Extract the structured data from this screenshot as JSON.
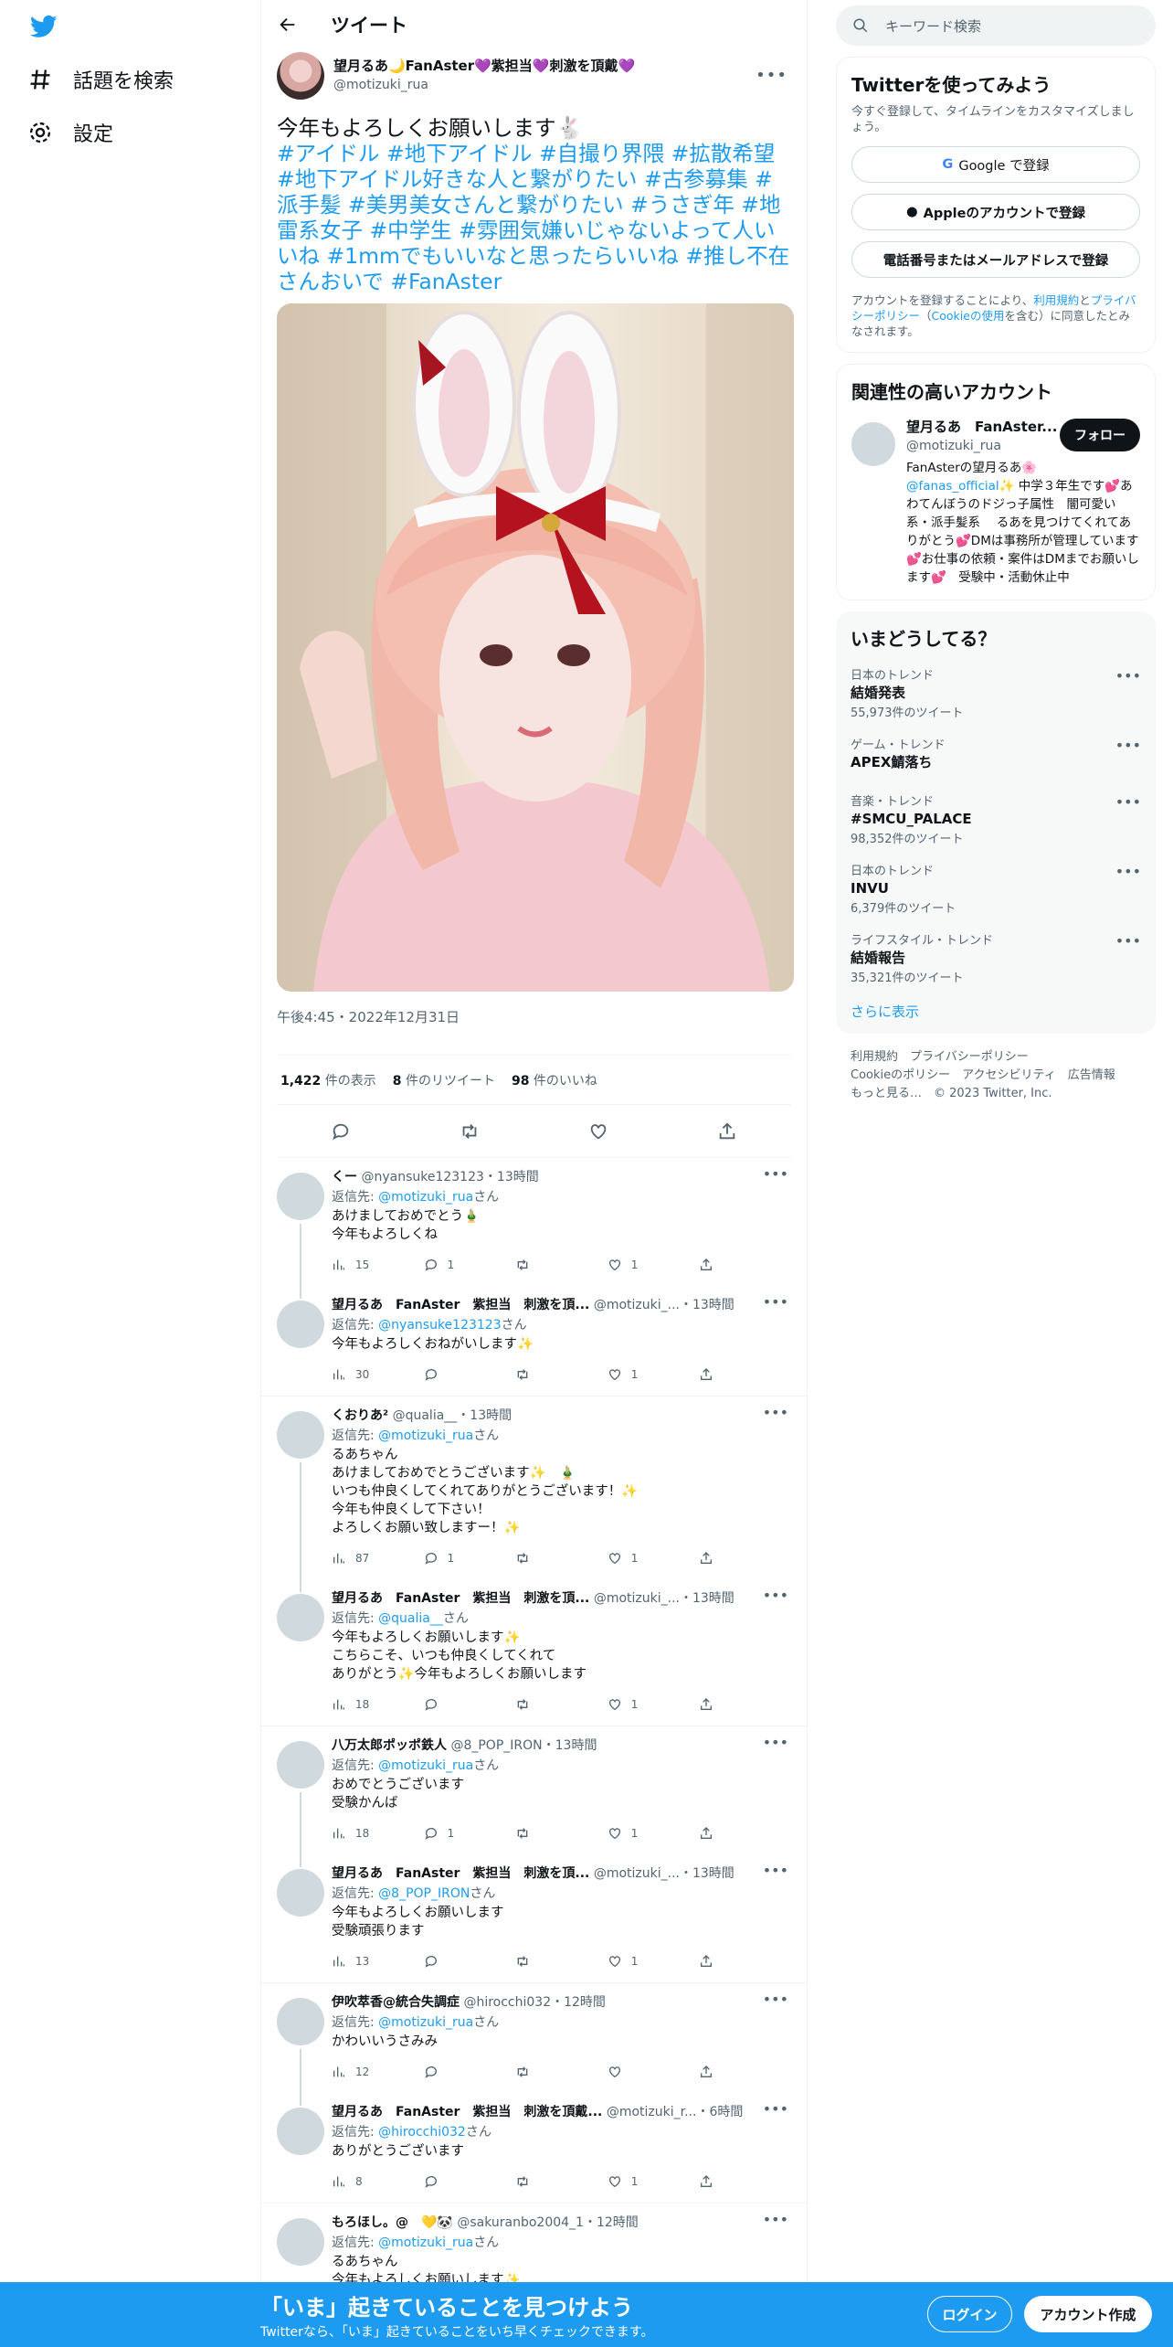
{
  "nav": {
    "explore": "話題を検索",
    "settings": "設定"
  },
  "header": {
    "title": "ツイート"
  },
  "tweet": {
    "name": "望月るあ🌙FanAster💜紫担当💜刺激を頂戴💜",
    "handle": "@motizuki_rua",
    "text": "今年もよろしくお願いします🐇",
    "tags": "#アイドル #地下アイドル #自撮り界隈 #拡散希望 #地下アイドル好きな人と繋がりたい #古参募集 #派手髪 #美男美女さんと繋がりたい #うさぎ年 #地雷系女子  #中学生 #雰囲気嫌いじゃないよって人いいね #1mmでもいいなと思ったらいいね #推し不在さんおいで #FanAster",
    "timestamp": "午後4:45・2022年12月31日",
    "views": "1,422",
    "views_label": "件の表示",
    "retweets": "8",
    "retweets_label": "件のリツイート",
    "likes": "98",
    "likes_label": "件のいいね"
  },
  "replies": [
    {
      "name": "くー",
      "handle": "@nyansuke123123",
      "time": "・13時間",
      "to": "@motizuki_rua",
      "san": "さん",
      "text": [
        "あけましておめでとう🎍",
        "今年もよろしくね"
      ],
      "views": "15",
      "replies": "1",
      "likes": "1"
    },
    {
      "name": "望月るあ　FanAster　紫担当　刺激を頂...",
      "handle": "@motizuki_...",
      "time": "・13時間",
      "to": "@nyansuke123123",
      "san": "さん",
      "text": [
        "今年もよろしくおねがいします✨"
      ],
      "views": "30",
      "replies": "",
      "likes": "1"
    },
    {
      "name": "くおりあ²",
      "handle": "@qualia__",
      "time": "・13時間",
      "to": "@motizuki_rua",
      "san": "さん",
      "text": [
        "るあちゃん",
        "あけましておめでとうございます✨　🎍",
        "いつも仲良くしてくれてありがとうございます！✨",
        "今年も仲良くして下さい！",
        "よろしくお願い致しますー！✨"
      ],
      "views": "87",
      "replies": "1",
      "likes": "1"
    },
    {
      "name": "望月るあ　FanAster　紫担当　刺激を頂...",
      "handle": "@motizuki_...",
      "time": "・13時間",
      "to": "@qualia__",
      "san": "さん",
      "text": [
        "今年もよろしくお願いします✨",
        "こちらこそ、いつも仲良くしてくれて",
        "ありがとう✨今年もよろしくお願いします"
      ],
      "views": "18",
      "replies": "",
      "likes": "1"
    },
    {
      "name": "八万太郎ポッポ鉄人",
      "handle": "@8_POP_IRON",
      "time": "・13時間",
      "to": "@motizuki_rua",
      "san": "さん",
      "text": [
        "おめでとうございます",
        "受験かんば"
      ],
      "views": "18",
      "replies": "1",
      "likes": "1"
    },
    {
      "name": "望月るあ　FanAster　紫担当　刺激を頂...",
      "handle": "@motizuki_...",
      "time": "・13時間",
      "to": "@8_POP_IRON",
      "san": "さん",
      "text": [
        "今年もよろしくお願いします",
        "受験頑張ります"
      ],
      "views": "13",
      "replies": "",
      "likes": "1"
    },
    {
      "name": "伊吹萃香@統合失調症",
      "handle": "@hirocchi032",
      "time": "・12時間",
      "to": "@motizuki_rua",
      "san": "さん",
      "text": [
        "かわいいうさみみ"
      ],
      "views": "12",
      "replies": "",
      "likes": ""
    },
    {
      "name": "望月るあ　FanAster　紫担当　刺激を頂戴...",
      "handle": "@motizuki_r...",
      "time": "・6時間",
      "to": "@hirocchi032",
      "san": "さん",
      "text": [
        "ありがとうございます"
      ],
      "views": "8",
      "replies": "",
      "likes": "1"
    },
    {
      "name": "もろほし。@　💛🐼",
      "handle": "@sakuranbo2004_1",
      "time": "・12時間",
      "to": "@motizuki_rua",
      "san": "さん",
      "text": [
        "るあちゃん",
        "今年もよろしくお願いします✨"
      ],
      "views": "",
      "replies": "",
      "likes": ""
    }
  ],
  "right": {
    "search_placeholder": "キーワード検索",
    "signup_title": "Twitterを使ってみよう",
    "signup_sub": "今すぐ登録して、タイムラインをカスタマイズしましょう。",
    "google": "Google で登録",
    "apple": "Appleのアカウントで登録",
    "phone": "電話番号またはメールアドレスで登録",
    "terms_pre": "アカウントを登録することにより、",
    "terms_link1": "利用規約",
    "terms_and": "と",
    "terms_link2": "プライバシーポリシー",
    "terms_paren": "（",
    "terms_link3": "Cookieの使用",
    "terms_post": "を含む）に同意したとみなされます。",
    "related_title": "関連性の高いアカウント",
    "acct_name": "望月るあ　FanAster...",
    "acct_handle": "@motizuki_rua",
    "follow": "フォロー",
    "bio_pre": "FanAsterの望月るあ🌸",
    "bio_link": "@fanas_official",
    "bio_post": "✨ 中学３年生です💕あわてんぼうのドジっ子属性　闇可愛い系・派手髪系　 るあを見つけてくれてありがとう💕DMは事務所が管理しています💕お仕事の依頼・案件はDMまでお願いします💕　受験中・活動休止中",
    "trends_title": "いまどうしてる？",
    "trends": [
      {
        "cat": "日本のトレンド",
        "name": "結婚発表",
        "count": "55,973件のツイート"
      },
      {
        "cat": "ゲーム・トレンド",
        "name": "APEX鯖落ち",
        "count": ""
      },
      {
        "cat": "音楽・トレンド",
        "name": "#SMCU_PALACE",
        "count": "98,352件のツイート"
      },
      {
        "cat": "日本のトレンド",
        "name": "INVU",
        "count": "6,379件のツイート"
      },
      {
        "cat": "ライフスタイル・トレンド",
        "name": "結婚報告",
        "count": "35,321件のツイート"
      }
    ],
    "show_more": "さらに表示",
    "footer": [
      "利用規約　プライバシーポリシー",
      "Cookieのポリシー　アクセシビリティ　広告情報",
      "もっと見る…　© 2023 Twitter, Inc."
    ]
  },
  "bottom": {
    "title": "「いま」起きていることを見つけよう",
    "sub": "Twitterなら、「いま」起きていることをいち早くチェックできます。",
    "login": "ログイン",
    "signup": "アカウント作成"
  },
  "colors": {
    "accent": "#1d9bf0",
    "text": "#0f1419",
    "secondary": "#536471"
  }
}
